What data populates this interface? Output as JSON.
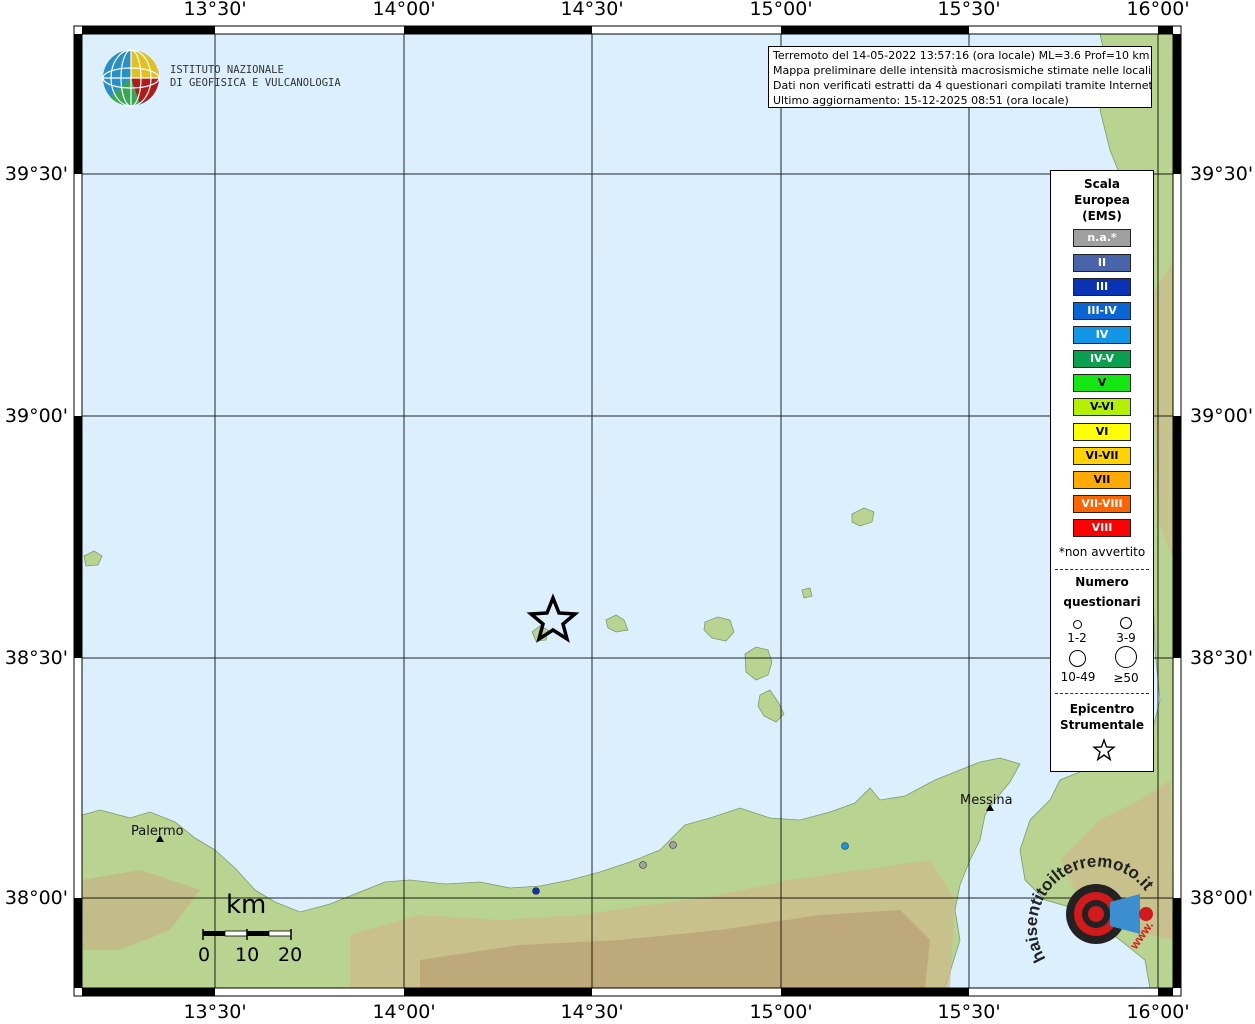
{
  "map": {
    "sea_color": "#dcefff",
    "land_color": "#b7d38f",
    "grid_labels": {
      "top": [
        "13°30'",
        "14°00'",
        "14°30'",
        "15°00'",
        "15°30'",
        "16°00'"
      ],
      "bottom": [
        "13°30'",
        "14°00'",
        "14°30'",
        "15°00'",
        "15°30'",
        "16°00'"
      ],
      "left": [
        "39°30'",
        "39°00'",
        "38°30'",
        "38°00'"
      ],
      "right": [
        "39°30'",
        "39°00'",
        "38°30'",
        "38°00'"
      ]
    },
    "places": [
      "Palermo",
      "Messina"
    ]
  },
  "logo": {
    "line1": "ISTITUTO NAZIONALE",
    "line2": "DI GEOFISICA E VULCANOLOGIA"
  },
  "info": {
    "line1": "Terremoto del 14-05-2022 13:57:16 (ora locale) ML=3.6 Prof=10 km",
    "line2": "Mappa preliminare delle intensità macrosismiche stimate nelle località",
    "line3": "Dati non verificati estratti da 4 questionari compilati tramite Internet.",
    "line4": "Ultimo aggiornamento: 15-12-2025 08:51 (ora locale)"
  },
  "legend": {
    "title1": "Scala",
    "title2": "Europea",
    "title3": "(EMS)",
    "scale": [
      {
        "label": "n.a.*",
        "color": "#a0a0a0"
      },
      {
        "label": "II",
        "color": "#4a64aa"
      },
      {
        "label": "III",
        "color": "#0a32b4"
      },
      {
        "label": "III-IV",
        "color": "#0a64d2"
      },
      {
        "label": "IV",
        "color": "#1496e6"
      },
      {
        "label": "IV-V",
        "color": "#0aa050"
      },
      {
        "label": "V",
        "color": "#14e614"
      },
      {
        "label": "V-VI",
        "color": "#b4f000"
      },
      {
        "label": "VI",
        "color": "#ffff00"
      },
      {
        "label": "VI-VII",
        "color": "#ffd200"
      },
      {
        "label": "VII",
        "color": "#ffaa00"
      },
      {
        "label": "VII-VIII",
        "color": "#ff6400"
      },
      {
        "label": "VIII",
        "color": "#ff0000"
      }
    ],
    "note": "*non avvertito",
    "count_title1": "Numero",
    "count_title2": "questionari",
    "counts": [
      "1-2",
      "3-9",
      "10-49",
      "≥50"
    ],
    "epicenter_title1": "Epicentro",
    "epicenter_title2": "Strumentale"
  },
  "scalebar": {
    "unit": "km",
    "labels": [
      "0",
      "10",
      "20"
    ]
  },
  "brand": {
    "text": "haisentitoilterremoto.it",
    "www": "www."
  }
}
